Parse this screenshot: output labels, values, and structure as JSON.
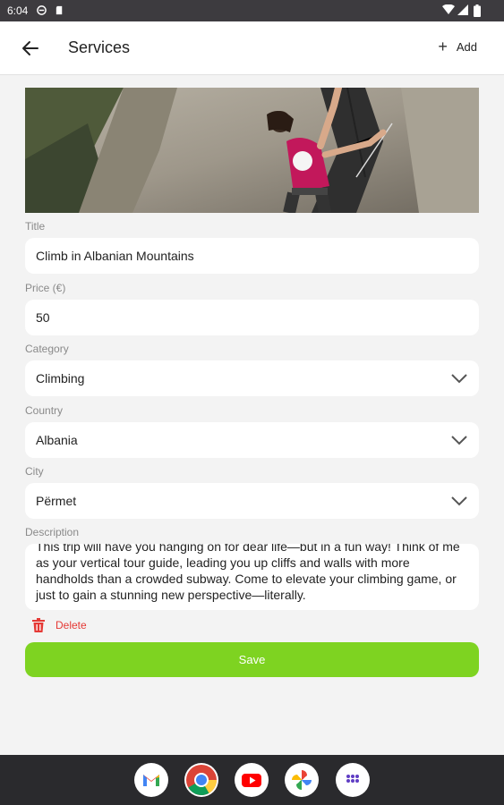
{
  "status_bar": {
    "time": "6:04",
    "left_icons": [
      "settings-sync-icon",
      "sd-card-icon"
    ],
    "right_icons": [
      "wifi-icon",
      "signal-icon",
      "battery-icon"
    ]
  },
  "app_bar": {
    "title": "Services",
    "add_label": "Add"
  },
  "hero_image": {
    "description_icon": "climber-photo"
  },
  "form": {
    "title_label": "Title",
    "title_value": "Climb in Albanian Mountains",
    "price_label": "Price (€)",
    "price_value": "50",
    "category_label": "Category",
    "category_value": "Climbing",
    "country_label": "Country",
    "country_value": "Albania",
    "city_label": "City",
    "city_value": "Përmet",
    "description_label": "Description",
    "description_value": "This trip will have you hanging on for dear life—but in a fun way! Think of me as your vertical tour guide, leading you up cliffs and walls with more handholds than a crowded subway. Come to elevate your climbing game, or just to gain a stunning new perspective—literally."
  },
  "actions": {
    "delete_label": "Delete",
    "save_label": "Save"
  },
  "colors": {
    "accent": "#7ed321",
    "danger": "#e53935",
    "status_bar": "#3d3b3f",
    "nav_bar": "#2a2a2d"
  },
  "dock": [
    "gmail-icon",
    "chrome-icon",
    "youtube-icon",
    "photos-icon",
    "app-drawer-icon"
  ]
}
